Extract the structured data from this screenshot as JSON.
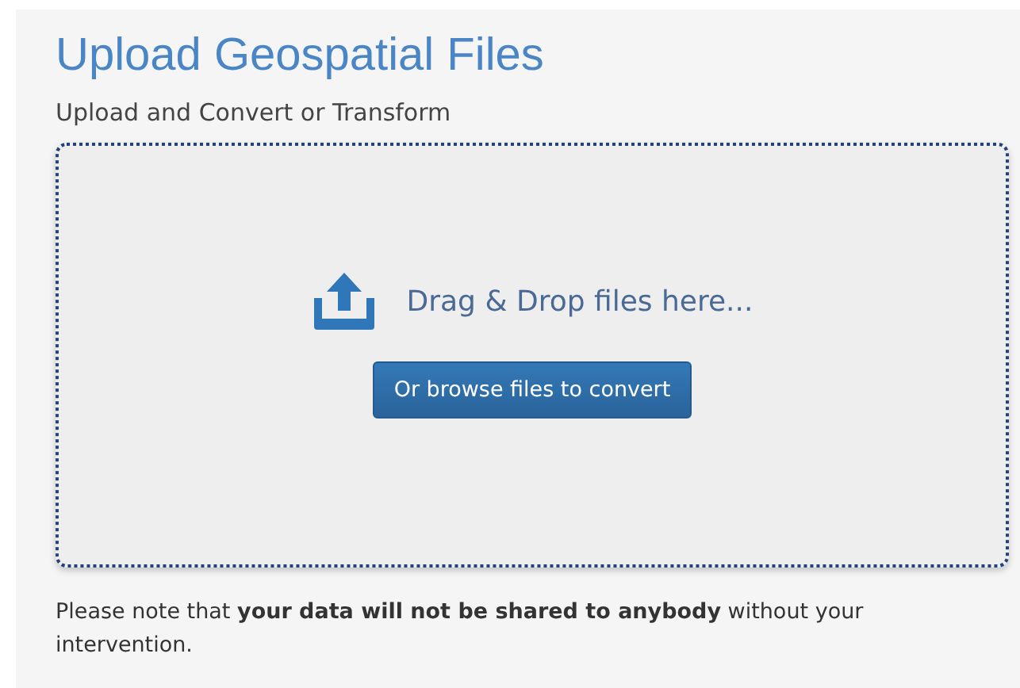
{
  "title": "Upload Geospatial Files",
  "subtitle": "Upload and Convert or Transform",
  "dropzone": {
    "prompt": "Drag & Drop files here...",
    "button": "Or browse files to convert"
  },
  "note": "Please note that **your data will not be shared to anybody** without your intervention."
}
